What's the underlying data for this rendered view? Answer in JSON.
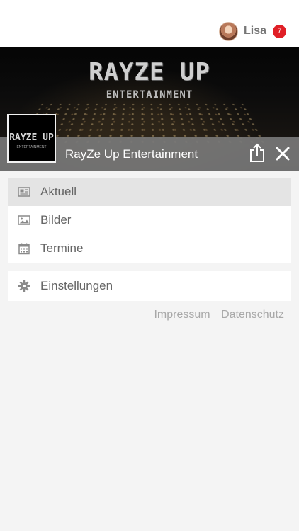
{
  "header": {
    "user_name": "Lisa",
    "notification_count": "7"
  },
  "hero": {
    "banner_title": "RAYZE UP",
    "banner_subtitle": "ENTERTAINMENT",
    "logo_title": "RAYZE UP",
    "logo_subtitle": "ENTERTAINMENT",
    "page_title": "RayZe Up Entertainment"
  },
  "menu": {
    "items": [
      {
        "label": "Aktuell",
        "icon": "newspaper-icon"
      },
      {
        "label": "Bilder",
        "icon": "image-icon"
      },
      {
        "label": "Termine",
        "icon": "calendar-icon"
      }
    ],
    "settings": {
      "label": "Einstellungen",
      "icon": "gear-icon"
    }
  },
  "footer": {
    "impressum": "Impressum",
    "datenschutz": "Datenschutz"
  },
  "colors": {
    "badge": "#e01f26",
    "hero_bar": "#787878",
    "active_item": "#e4e4e4"
  }
}
